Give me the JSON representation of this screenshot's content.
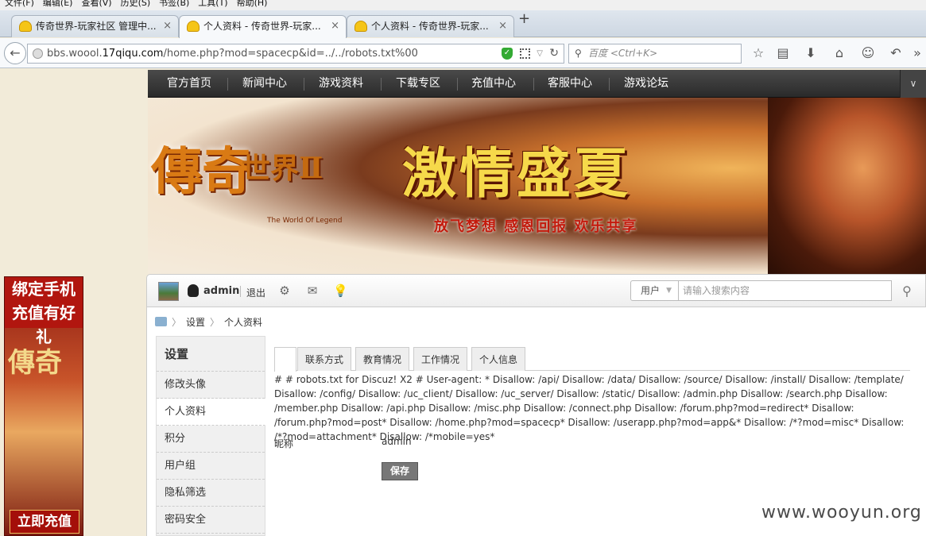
{
  "menubar": [
    "文件(F)",
    "编辑(E)",
    "查看(V)",
    "历史(S)",
    "书签(B)",
    "工具(T)",
    "帮助(H)"
  ],
  "tabs": [
    {
      "label": "传奇世界-玩家社区 管理中...",
      "close": "×"
    },
    {
      "label": "个人资料 - 传奇世界-玩家...",
      "close": "×"
    },
    {
      "label": "个人资料 - 传奇世界-玩家...",
      "close": "×"
    }
  ],
  "new_tab": "+",
  "address_bar": {
    "url_prefix": "bbs.woool.",
    "url_domain": "17qiqu.com",
    "url_path": "/home.php?mod=spacecp&id=../../robots.txt%00"
  },
  "search_bar": {
    "placeholder": "百度 <Ctrl+K>"
  },
  "left_banner": {
    "line1": "绑定手机",
    "line2": "充值有好礼",
    "logo": "傳奇",
    "button": "立即充值"
  },
  "site_nav": {
    "items": [
      "官方首页",
      "新闻中心",
      "游戏资料",
      "下载专区",
      "充值中心",
      "客服中心",
      "游戏论坛"
    ],
    "expand": "∨"
  },
  "hero": {
    "logo_main": "傳奇",
    "logo_secondary": "世界Ⅱ",
    "logo_sub": "The World Of Legend",
    "headline": "激情盛夏",
    "slogan": "放飞梦想  感恩回报  欢乐共享"
  },
  "user_bar": {
    "username": "admin",
    "logout": "退出",
    "search_type": "用户",
    "search_placeholder": "请输入搜索内容"
  },
  "breadcrumb": {
    "items": [
      "设置",
      "个人资料"
    ]
  },
  "sidebar": {
    "title": "设置",
    "items": [
      "修改头像",
      "个人资料",
      "积分",
      "用户组",
      "隐私筛选",
      "密码安全"
    ],
    "current_index": 1
  },
  "profile_tabs": [
    "",
    "联系方式",
    "教育情况",
    "工作情况",
    "个人信息"
  ],
  "robots_text": "# # robots.txt for Discuz! X2 # User-agent: * Disallow: /api/ Disallow: /data/ Disallow: /source/ Disallow: /install/ Disallow: /template/ Disallow: /config/ Disallow: /uc_client/ Disallow: /uc_server/ Disallow: /static/ Disallow: /admin.php Disallow: /search.php Disallow: /member.php Disallow: /api.php Disallow: /misc.php Disallow: /connect.php Disallow: /forum.php?mod=redirect* Disallow: /forum.php?mod=post* Disallow: /home.php?mod=spacecp* Disallow: /userapp.php?mod=app&* Disallow: /*?mod=misc* Disallow: /*?mod=attachment* Disallow: /*mobile=yes*",
  "form": {
    "nickname_label": "昵称",
    "nickname_value": "admin",
    "save": "保存"
  },
  "watermark": "www.wooyun.org",
  "icons": [
    "back-icon",
    "globe-icon",
    "shield-icon",
    "qr-icon",
    "reload-icon",
    "search-icon",
    "star-icon",
    "reader-icon",
    "download-icon",
    "home-icon",
    "chat-icon",
    "undo-icon",
    "settings-icon",
    "mail-icon",
    "bulb-icon",
    "qq-icon"
  ],
  "colors": {
    "nav_bg": "#2a2a2a",
    "headline": "#f6d94a",
    "slogan": "#c31a0c",
    "save_button": "#777777"
  }
}
